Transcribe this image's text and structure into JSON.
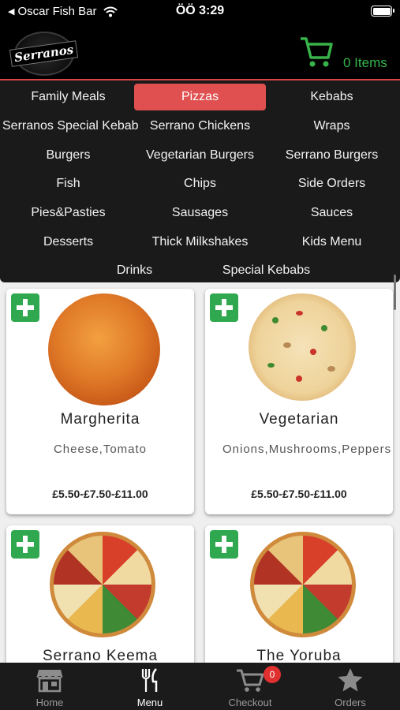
{
  "status_bar": {
    "back_label": "Oscar Fish Bar",
    "time": "ÖÖ 3:29"
  },
  "header": {
    "logo_text": "Serranos",
    "cart_label": "0 Items",
    "cart_color": "#37b34a"
  },
  "categories": [
    {
      "label": "Family Meals"
    },
    {
      "label": "Pizzas",
      "active": true
    },
    {
      "label": "Kebabs"
    },
    {
      "label": "Serranos Special Kebab"
    },
    {
      "label": "Serrano Chickens"
    },
    {
      "label": "Wraps"
    },
    {
      "label": "Burgers"
    },
    {
      "label": "Vegetarian Burgers"
    },
    {
      "label": "Serrano Burgers"
    },
    {
      "label": "Fish"
    },
    {
      "label": "Chips"
    },
    {
      "label": "Side Orders"
    },
    {
      "label": "Pies&Pasties"
    },
    {
      "label": "Sausages"
    },
    {
      "label": "Sauces"
    },
    {
      "label": "Desserts"
    },
    {
      "label": "Thick Milkshakes"
    },
    {
      "label": "Kids Menu"
    },
    {
      "label": "Drinks"
    },
    {
      "label": "Special Kebabs"
    }
  ],
  "products": [
    {
      "name": "Margherita",
      "description": "Cheese,Tomato",
      "price": "£5.50-£7.50-£11.00"
    },
    {
      "name": "Vegetarian",
      "description": "Onions,Mushrooms,Peppers",
      "price": "£5.50-£7.50-£11.00"
    },
    {
      "name": "Serrano Keema"
    },
    {
      "name": "The Yoruba"
    }
  ],
  "bottom_nav": {
    "home": "Home",
    "menu": "Menu",
    "checkout": "Checkout",
    "checkout_badge": "0",
    "orders": "Orders"
  },
  "colors": {
    "accent_red": "#e05050",
    "add_green": "#2fa84f"
  }
}
